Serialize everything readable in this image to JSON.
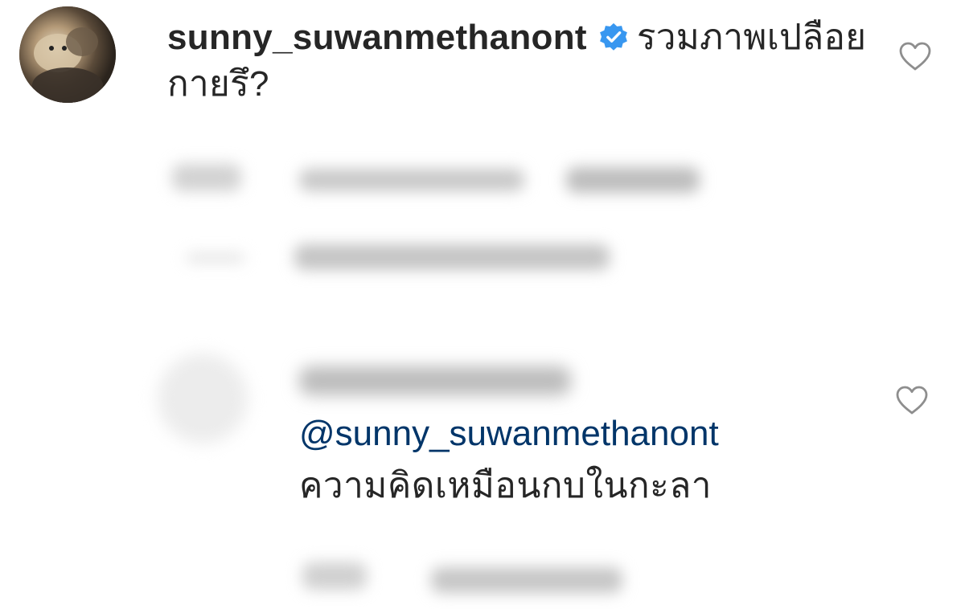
{
  "comment_primary": {
    "username": "sunny_suwanmethanont",
    "verified": true,
    "text": "รวมภาพเปลือยกายรึ?",
    "like_icon": "heart-outline-icon"
  },
  "comment_secondary": {
    "mention": "@sunny_suwanmethanont",
    "text": "ความคิดเหมือนกบในกะลา",
    "like_icon": "heart-outline-icon"
  },
  "colors": {
    "verified_badge": "#3897f0",
    "mention_link": "#003569",
    "text": "#262626",
    "heart_outline": "#8e8e8e"
  }
}
